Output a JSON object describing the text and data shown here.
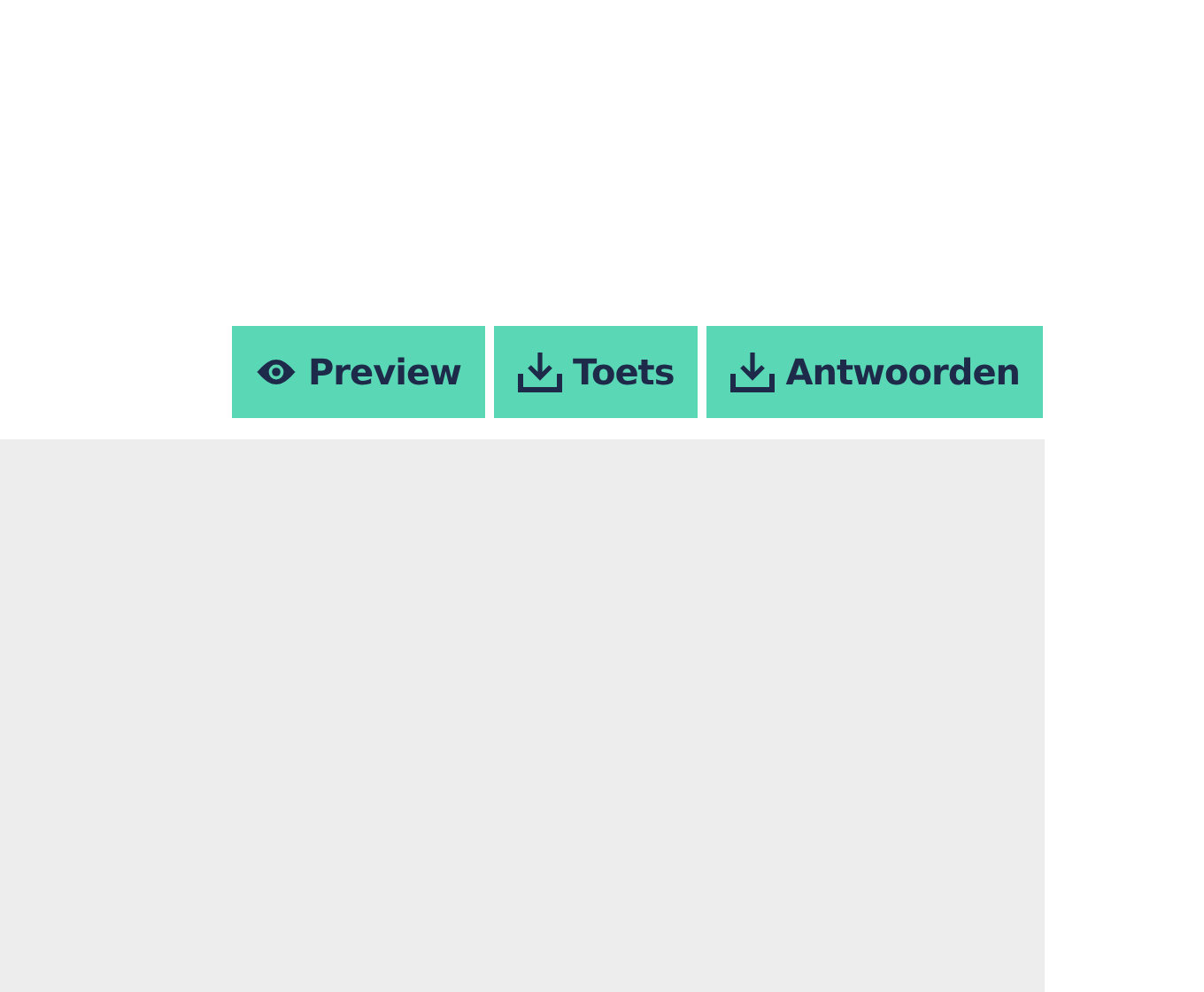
{
  "buttons": [
    {
      "label": "Preview",
      "kind": "view"
    },
    {
      "label": "Toets",
      "kind": "download"
    },
    {
      "label": "Antwoorden",
      "kind": "download"
    }
  ]
}
